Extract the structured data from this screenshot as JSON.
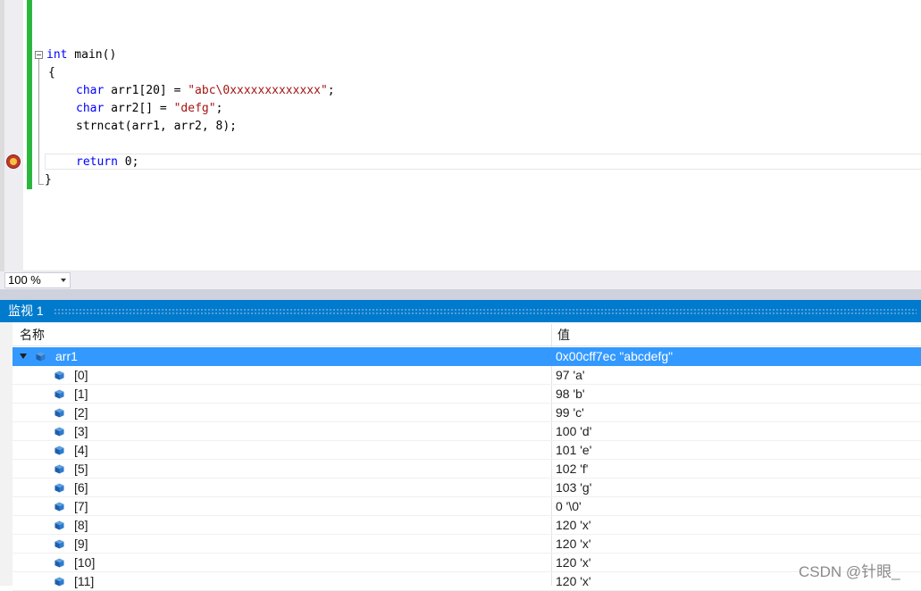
{
  "editor": {
    "lines": [
      {
        "id": "main",
        "parts": [
          {
            "t": "int",
            "c": "kw"
          },
          {
            "t": " main()",
            "c": ""
          }
        ]
      },
      {
        "id": "brace-open",
        "parts": [
          {
            "t": "{",
            "c": ""
          }
        ]
      },
      {
        "id": "arr1-decl",
        "parts": [
          {
            "t": "char",
            "c": "kw"
          },
          {
            "t": " arr1[20] = ",
            "c": ""
          },
          {
            "t": "\"abc\\0xxxxxxxxxxxxx\"",
            "c": "str"
          },
          {
            "t": ";",
            "c": ""
          }
        ]
      },
      {
        "id": "arr2-decl",
        "parts": [
          {
            "t": "char",
            "c": "kw"
          },
          {
            "t": " arr2[] = ",
            "c": ""
          },
          {
            "t": "\"defg\"",
            "c": "str"
          },
          {
            "t": ";",
            "c": ""
          }
        ]
      },
      {
        "id": "strncat-call",
        "parts": [
          {
            "t": "strncat(arr1, arr2, 8);",
            "c": ""
          }
        ]
      },
      {
        "id": "return-stmt",
        "parts": [
          {
            "t": "return",
            "c": "kw"
          },
          {
            "t": " 0;",
            "c": ""
          }
        ]
      },
      {
        "id": "brace-close",
        "parts": [
          {
            "t": "}",
            "c": ""
          }
        ]
      }
    ]
  },
  "zoom": {
    "value": "100 %"
  },
  "watch": {
    "title": "监视 1",
    "col_name": "名称",
    "col_value": "值",
    "root": {
      "name": "arr1",
      "value": "0x00cff7ec \"abcdefg\""
    },
    "items": [
      {
        "name": "[0]",
        "value": "97 'a'"
      },
      {
        "name": "[1]",
        "value": "98 'b'"
      },
      {
        "name": "[2]",
        "value": "99 'c'"
      },
      {
        "name": "[3]",
        "value": "100 'd'"
      },
      {
        "name": "[4]",
        "value": "101 'e'"
      },
      {
        "name": "[5]",
        "value": "102 'f'"
      },
      {
        "name": "[6]",
        "value": "103 'g'"
      },
      {
        "name": "[7]",
        "value": "0 '\\0'"
      },
      {
        "name": "[8]",
        "value": "120 'x'"
      },
      {
        "name": "[9]",
        "value": "120 'x'"
      },
      {
        "name": "[10]",
        "value": "120 'x'"
      },
      {
        "name": "[11]",
        "value": "120 'x'"
      }
    ]
  },
  "watermark": "CSDN @针眼_",
  "colors": {
    "accent": "#007acc",
    "selection": "#3399ff",
    "change_bar": "#2bb73f",
    "keyword": "#0000ff",
    "string": "#a31515"
  }
}
